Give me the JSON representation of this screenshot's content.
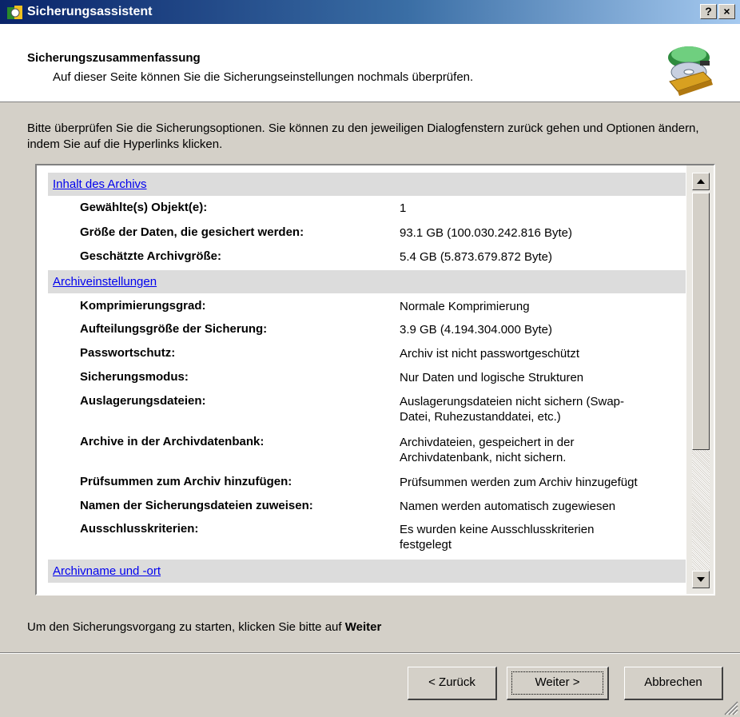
{
  "window": {
    "title": "Sicherungsassistent",
    "help_label": "?",
    "close_label": "×"
  },
  "header": {
    "title": "Sicherungszusammenfassung",
    "subtitle": "Auf dieser Seite können Sie die Sicherungseinstellungen nochmals überprüfen."
  },
  "intro": "Bitte überprüfen Sie die Sicherungsoptionen. Sie können zu den jeweiligen Dialogfenstern zurück gehen und Optionen ändern, indem Sie auf die Hyperlinks klicken.",
  "sections": [
    {
      "link": "Inhalt des Archivs",
      "rows": [
        {
          "label": "Gewählte(s) Objekt(e):",
          "value": "1"
        },
        {
          "label": "Größe der Daten, die gesichert werden:",
          "value": "93.1 GB (100.030.242.816 Byte)"
        },
        {
          "label": "Geschätzte Archivgröße:",
          "value": "5.4 GB (5.873.679.872 Byte)"
        }
      ]
    },
    {
      "link": "Archiveinstellungen",
      "rows": [
        {
          "label": "Komprimierungsgrad:",
          "value": "Normale Komprimierung"
        },
        {
          "label": "Aufteilungsgröße der Sicherung:",
          "value": "3.9 GB (4.194.304.000 Byte)"
        },
        {
          "label": "Passwortschutz:",
          "value": "Archiv ist nicht passwortgeschützt"
        },
        {
          "label": "Sicherungsmodus:",
          "value": "Nur Daten und logische Strukturen"
        },
        {
          "label": "Auslagerungsdateien:",
          "value": "Auslagerungsdateien nicht sichern (Swap-Datei, Ruhezustanddatei, etc.)"
        },
        {
          "label": "Archive in der Archivdatenbank:",
          "value": "Archivdateien, gespeichert in der Archivdatenbank, nicht sichern."
        },
        {
          "label": "Prüfsummen zum Archiv hinzufügen:",
          "value": "Prüfsummen werden zum Archiv hinzugefügt"
        },
        {
          "label": "Namen der Sicherungsdateien zuweisen:",
          "value": "Namen werden automatisch zugewiesen"
        },
        {
          "label": "Ausschlusskriterien:",
          "value": "Es wurden keine Ausschlusskriterien festgelegt"
        }
      ]
    },
    {
      "link": "Archivname und -ort",
      "rows": []
    }
  ],
  "footer": {
    "text": "Um den Sicherungsvorgang zu starten, klicken Sie bitte auf",
    "emphasis": "Weiter"
  },
  "buttons": {
    "back": "< Zurück",
    "next": "Weiter >",
    "cancel": "Abbrechen"
  },
  "icons": {
    "app": "backup-app-icon",
    "header": "backup-disc-icon",
    "scroll_up": "arrow-up-icon",
    "scroll_down": "arrow-down-icon",
    "grip": "resize-grip-icon"
  }
}
